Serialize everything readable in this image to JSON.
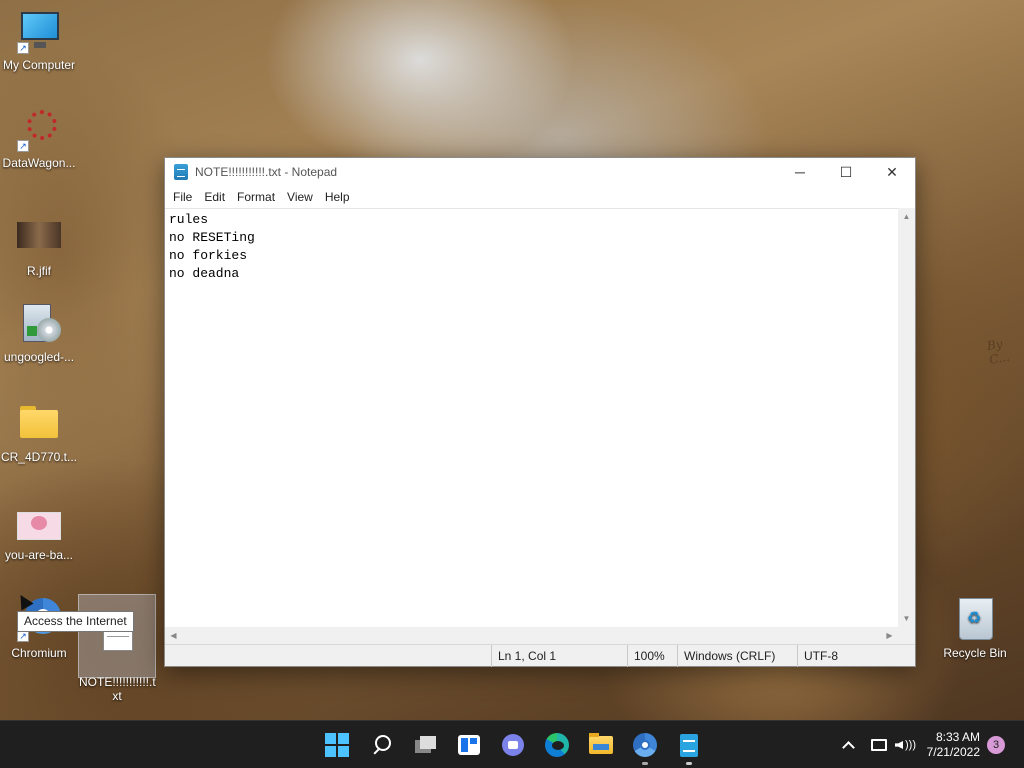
{
  "desktop": {
    "icons": [
      {
        "label": "My Computer",
        "icon": "monitor-icon"
      },
      {
        "label": "DataWagon...",
        "icon": "datawagon-icon"
      },
      {
        "label": "R.jfif",
        "icon": "image-thumbnail-icon"
      },
      {
        "label": "ungoogled-...",
        "icon": "installer-icon"
      },
      {
        "label": "CR_4D770.t...",
        "icon": "folder-icon"
      },
      {
        "label": "you-are-ba...",
        "icon": "image-thumbnail-icon"
      },
      {
        "label": "Chromium",
        "icon": "chromium-icon"
      },
      {
        "label": "NOTE!!!!!!!!!!!.t\nxt",
        "icon": "text-file-icon"
      },
      {
        "label": "Recycle Bin",
        "icon": "recycle-bin-icon"
      }
    ],
    "tooltip": "Access the Internet",
    "wallpaper_watermark": "By C..."
  },
  "notepad": {
    "title": "NOTE!!!!!!!!!!!.txt - Notepad",
    "controls": {
      "minimize": "─",
      "maximize": "☐",
      "close": "✕"
    },
    "menu": [
      "File",
      "Edit",
      "Format",
      "View",
      "Help"
    ],
    "content": "rules\nno RESETing\nno forkies\nno deadna",
    "status": {
      "position": "Ln 1, Col 1",
      "zoom": "100%",
      "line_ending": "Windows (CRLF)",
      "encoding": "UTF-8"
    }
  },
  "taskbar": {
    "apps": [
      "start-icon",
      "search-icon",
      "task-view-icon",
      "widgets-icon",
      "chat-icon",
      "edge-icon",
      "file-explorer-icon",
      "chromium-icon",
      "notepad-icon"
    ],
    "clock_time": "8:33 AM",
    "clock_date": "7/21/2022",
    "notification_count": "3",
    "accent": "#0078d4"
  }
}
